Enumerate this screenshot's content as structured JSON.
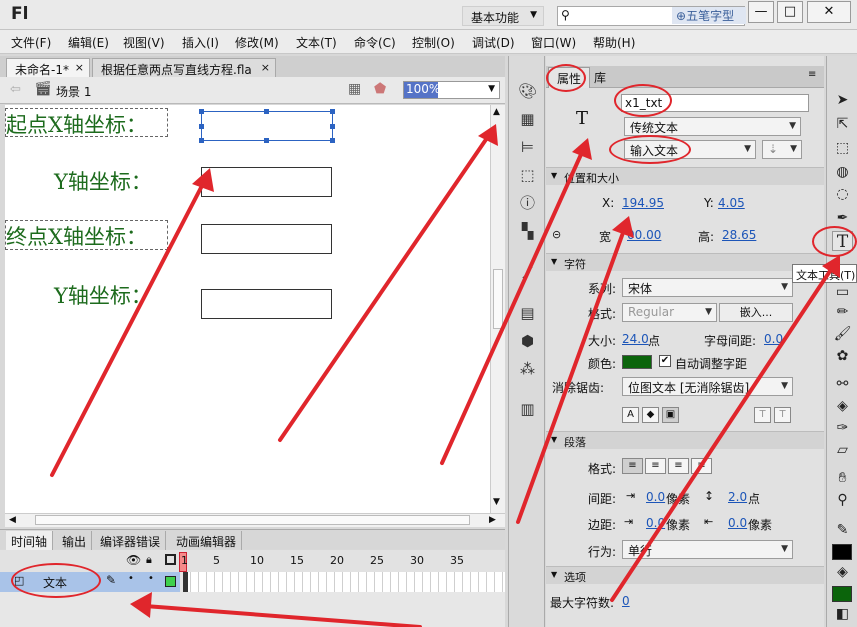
{
  "app": {
    "logo": "Fl",
    "workspace": "基本功能",
    "watermark": "五笔字型"
  },
  "window_controls": {
    "minimize": "—",
    "maximize": "□",
    "close": "✕"
  },
  "menu": [
    "文件(F)",
    "编辑(E)",
    "视图(V)",
    "插入(I)",
    "修改(M)",
    "文本(T)",
    "命令(C)",
    "控制(O)",
    "调试(D)",
    "窗口(W)",
    "帮助(H)"
  ],
  "doc_tabs": [
    {
      "label": "未命名-1*",
      "close": "×"
    },
    {
      "label": "根据任意两点写直线方程.fla",
      "close": "×"
    }
  ],
  "scene": {
    "label": "场景 1",
    "zoom": "100%"
  },
  "stage": {
    "start_x_label": "起点X轴坐标：",
    "start_y_label": "Y轴坐标：",
    "end_x_label": "终点X轴坐标：",
    "end_y_label": "Y轴坐标："
  },
  "timeline": {
    "tabs": [
      "时间轴",
      "输出",
      "编译器错误",
      "动画编辑器"
    ],
    "frame_numbers": [
      "1",
      "5",
      "10",
      "15",
      "20",
      "25",
      "30",
      "35"
    ],
    "layer_name": "文本"
  },
  "properties": {
    "tabs": [
      "属性",
      "库"
    ],
    "instance_name": "x1_txt",
    "text_engine": "传统文本",
    "text_type": "输入文本",
    "section_position": "位置和大小",
    "x_label": "X:",
    "x_value": "194.95",
    "y_label": "Y:",
    "y_value": "4.05",
    "width_label": "宽",
    "width_value": "00.00",
    "height_label": "高:",
    "height_value": "28.65",
    "section_char": "字符",
    "family_label": "系列:",
    "family_value": "宋体",
    "style_label": "格式:",
    "style_value": "Regular",
    "embed_button": "嵌入...",
    "size_label": "大小:",
    "size_value": "24.0",
    "size_unit": "点",
    "spacing_label": "字母间距:",
    "spacing_value": "0.0",
    "color_label": "颜色:",
    "color_value": "#0b640b",
    "kerning_label": "自动调整字距",
    "antialias_label": "消除锯齿:",
    "antialias_value": "位图文本 [无消除锯齿]",
    "section_para": "段落",
    "format_label": "格式:",
    "spacing2_label": "间距:",
    "indent_value": "0.0",
    "indent_unit": "像素",
    "leading_value": "2.0",
    "leading_unit": "点",
    "margin_label": "边距:",
    "left_margin": "0.0",
    "left_unit": "像素",
    "right_margin": "0.0",
    "right_unit": "像素",
    "behavior_label": "行为:",
    "behavior_value": "单行",
    "section_options": "选项",
    "maxchars_label": "最大字符数:",
    "maxchars_value": "0"
  },
  "tooltip": "文本工具(T)",
  "colors": {
    "stage_text": "#1d6b1d",
    "annotation": "#e0262c",
    "stroke_swatch": "#000000",
    "fill_swatch": "#0b640b"
  }
}
